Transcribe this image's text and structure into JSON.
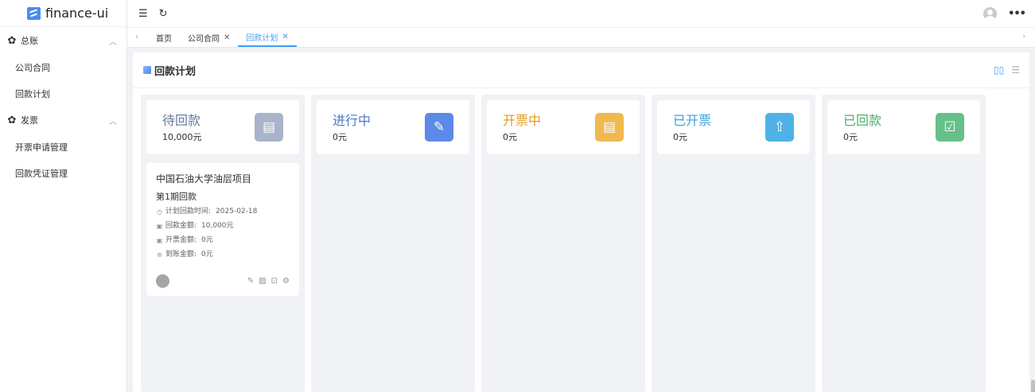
{
  "app": {
    "name": "finance-ui"
  },
  "sidebar": {
    "groups": [
      {
        "title": "总账",
        "items": [
          "公司合同",
          "回款计划"
        ]
      },
      {
        "title": "发票",
        "items": [
          "开票申请管理",
          "回款凭证管理"
        ]
      }
    ]
  },
  "tabs": [
    {
      "label": "首页",
      "closable": false
    },
    {
      "label": "公司合同",
      "closable": true
    },
    {
      "label": "回款计划",
      "closable": true
    }
  ],
  "page": {
    "title": "回款计划"
  },
  "columns": [
    {
      "title": "待回款",
      "amount": "10,000元",
      "color": "#6b7b9e",
      "icon_bg": "#a9b3c9",
      "icon": "doc-clock-icon"
    },
    {
      "title": "进行中",
      "amount": "0元",
      "color": "#4a78c8",
      "icon_bg": "#5b8ae8",
      "icon": "doc-edit-icon"
    },
    {
      "title": "开票中",
      "amount": "0元",
      "color": "#e59a1a",
      "icon_bg": "#f0b94f",
      "icon": "doc-stamp-icon"
    },
    {
      "title": "已开票",
      "amount": "0元",
      "color": "#3aa1d6",
      "icon_bg": "#4eb2e6",
      "icon": "receipt-up-icon"
    },
    {
      "title": "已回款",
      "amount": "0元",
      "color": "#4caf6d",
      "icon_bg": "#66c088",
      "icon": "inbox-check-icon"
    }
  ],
  "card": {
    "title": "中国石油大学油层项目",
    "subtitle": "第1期回款",
    "fields": [
      {
        "label": "计划回款时间:",
        "value": "2025-02-18"
      },
      {
        "label": "回款金额:",
        "value": "10,000元"
      },
      {
        "label": "开票金额:",
        "value": "0元"
      },
      {
        "label": "到账金额:",
        "value": "0元"
      }
    ]
  }
}
